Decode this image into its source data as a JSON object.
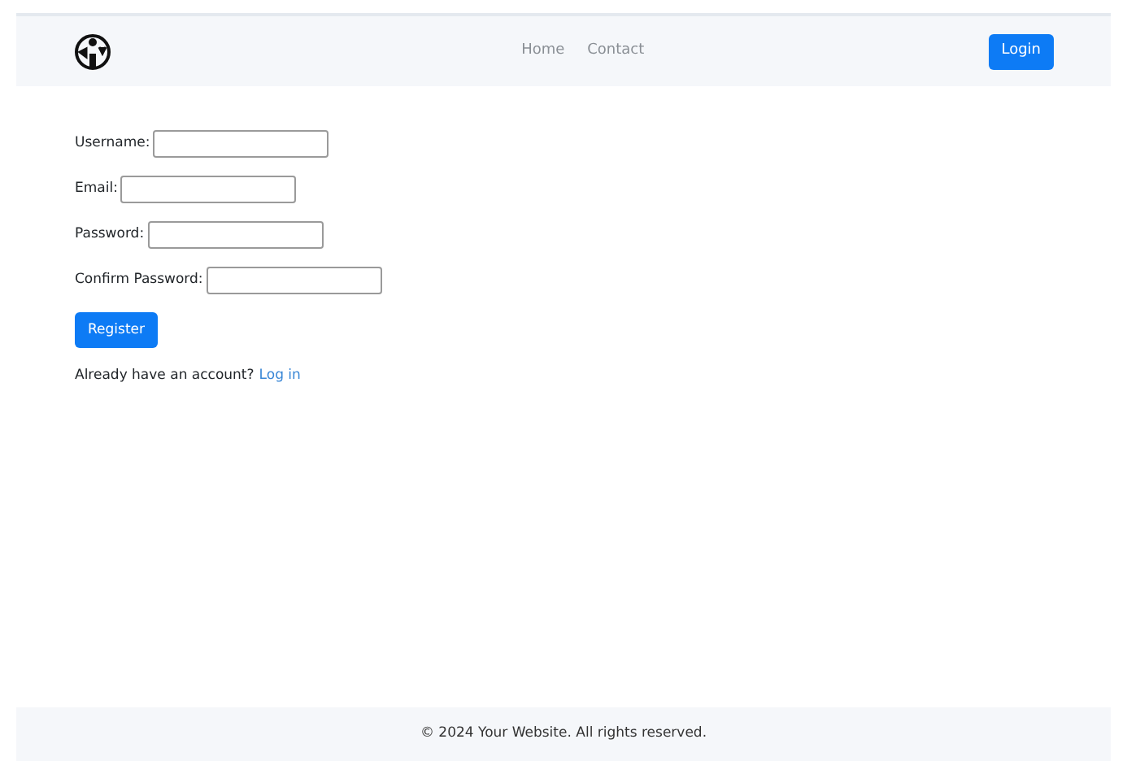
{
  "nav": {
    "links": [
      "Home",
      "Contact"
    ],
    "login_button": "Login"
  },
  "form": {
    "fields": [
      {
        "label": "Username:"
      },
      {
        "label": "Email:"
      },
      {
        "label": "Password:"
      },
      {
        "label": "Confirm Password:"
      }
    ],
    "submit": "Register",
    "prompt": "Already have an account?",
    "prompt_link": "Log in"
  },
  "footer": "© 2024 Your Website. All rights reserved."
}
